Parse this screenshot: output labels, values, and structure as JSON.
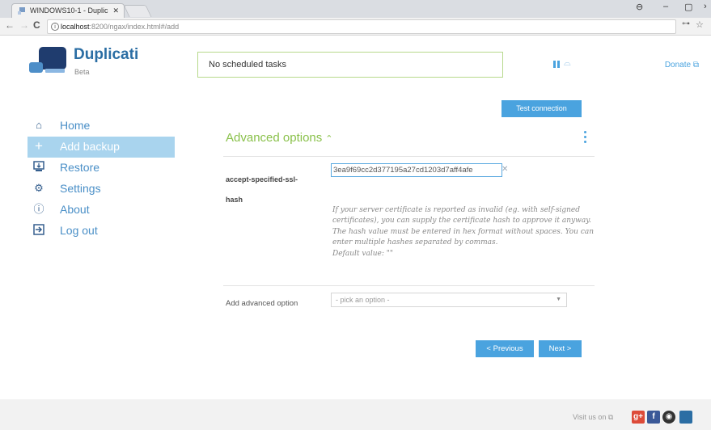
{
  "browser": {
    "tab_title": "WINDOWS10-1 - Duplic",
    "url_host": "localhost",
    "url_path": ":8200/ngax/index.html#/add"
  },
  "header": {
    "brand": "Duplicati",
    "brand_sub": "Beta",
    "status_text": "No scheduled tasks",
    "donate": "Donate"
  },
  "sidebar": {
    "items": [
      {
        "label": "Home",
        "icon": "home-icon"
      },
      {
        "label": "Add backup",
        "icon": "plus-icon"
      },
      {
        "label": "Restore",
        "icon": "restore-icon"
      },
      {
        "label": "Settings",
        "icon": "gear-icon"
      },
      {
        "label": "About",
        "icon": "info-icon"
      },
      {
        "label": "Log out",
        "icon": "logout-icon"
      }
    ]
  },
  "main": {
    "test_connection": "Test connection",
    "section_title": "Advanced options",
    "option_name_1": "accept-specified-ssl-",
    "option_name_2": "hash",
    "option_value": "3ea9f69cc2d377195a27cd1203d7aff4afe",
    "option_description": "If your server certificate is reported as invalid (eg. with self-signed certificates), you can supply the certificate hash to approve it anyway. The hash value must be entered in hex format without spaces. You can enter multiple hashes separated by commas.",
    "option_default": "Default value: \"\"",
    "add_option_label": "Add advanced option",
    "add_option_placeholder": "- pick an option -",
    "previous": "< Previous",
    "next": "Next >"
  },
  "footer": {
    "visit": "Visit us on"
  },
  "colors": {
    "accent": "#4aa3df",
    "green": "#8ac14b",
    "active_nav": "#a9d4ee"
  }
}
